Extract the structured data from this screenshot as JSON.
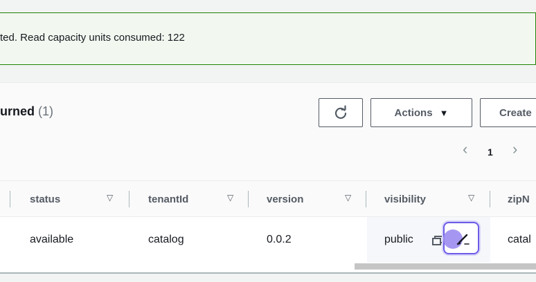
{
  "banner": {
    "message": "ted. Read capacity units consumed: 122"
  },
  "panel": {
    "title": "urned",
    "count": "(1)"
  },
  "toolbar": {
    "refresh_icon": "refresh-icon",
    "actions_label": "Actions",
    "actions_caret": "▼",
    "create_label": "Create"
  },
  "pagination": {
    "prev": "‹",
    "current_page": "1",
    "next": "›"
  },
  "table": {
    "columns": [
      {
        "label": "status",
        "sort": "▽"
      },
      {
        "label": "tenantId",
        "sort": "▽"
      },
      {
        "label": "version",
        "sort": "▽"
      },
      {
        "label": "visibility",
        "sort": "▽"
      },
      {
        "label": "zipN"
      }
    ],
    "rows": [
      {
        "status": "available",
        "tenantId": "catalog",
        "version": "0.0.2",
        "visibility": "public",
        "zipN": "catal"
      }
    ]
  },
  "colors": {
    "success_border": "#1d8102",
    "success_bg": "#f2f8f0",
    "focus_ring": "#6c5ce7"
  }
}
